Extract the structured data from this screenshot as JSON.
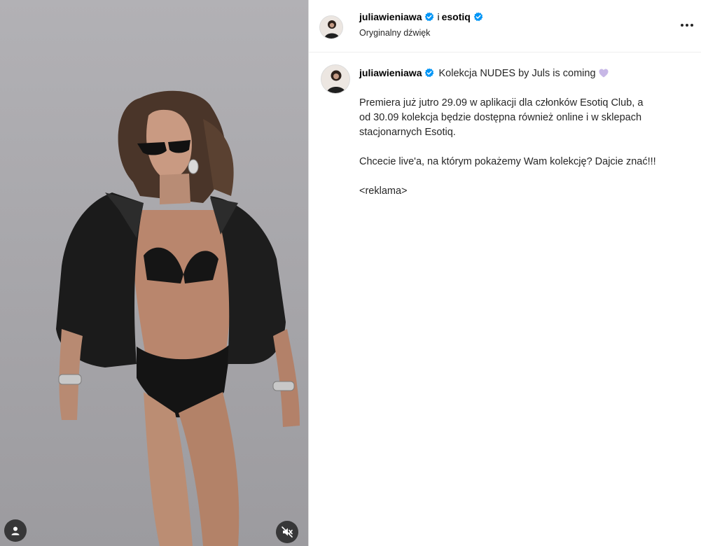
{
  "header": {
    "username": "juliawieniawa",
    "joiner": "i",
    "collaborator": "esotiq",
    "audio": "Oryginalny dźwięk"
  },
  "caption": {
    "username": "juliawieniawa",
    "headline": "Kolekcja NUDES by Juls is coming",
    "paragraph1": [
      "Premiera już jutro 29.09 w aplikacji dla członków Esotiq Club, a",
      "od 30.09 kolekcja będzie dostępna również online i w sklepach",
      "stacjonarnych Esotiq."
    ],
    "paragraph2": "Chcecie live'a, na którym pokażemy Wam kolekcję? Dajcie znać!!!",
    "paragraph3": "<reklama>"
  },
  "icons": {
    "verified": "verified-badge-icon",
    "more": "more-options-icon",
    "tag": "tagged-user-icon",
    "mute": "audio-muted-icon",
    "heart": "purple-heart-emoji"
  },
  "colors": {
    "verified": "#0095f6",
    "heart": "#c7b7e6",
    "border": "#dbdbdb"
  }
}
